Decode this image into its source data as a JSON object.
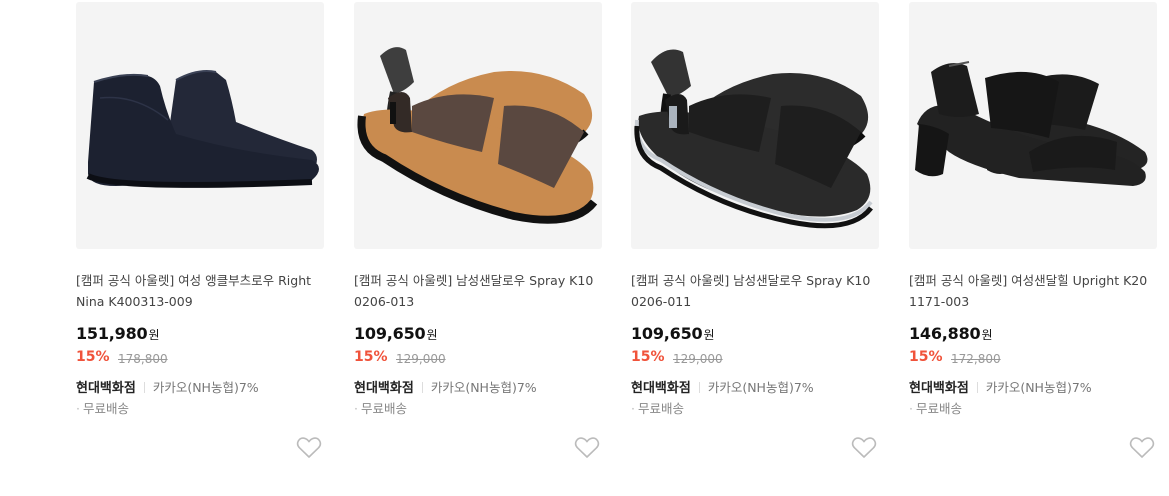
{
  "products": [
    {
      "title": "[캠퍼 공식 아울렛] 여성 앵클부츠로우 Right Nina K400313-009",
      "price": "151,980",
      "currency": "원",
      "discount": "15%",
      "original_price": "178,800",
      "seller": "현대백화점",
      "promo": "카카오(NH농협)7%",
      "shipping": "무료배송",
      "image_icon": "ankle-boot-image",
      "color": "#1f2433"
    },
    {
      "title": "[캠퍼 공식 아울렛] 남성샌달로우 Spray K100206-013",
      "price": "109,650",
      "currency": "원",
      "discount": "15%",
      "original_price": "129,000",
      "seller": "현대백화점",
      "promo": "카카오(NH농협)7%",
      "shipping": "무료배송",
      "image_icon": "sandal-image",
      "color": "#5b4a42"
    },
    {
      "title": "[캠퍼 공식 아울렛] 남성샌달로우 Spray K100206-011",
      "price": "109,650",
      "currency": "원",
      "discount": "15%",
      "original_price": "129,000",
      "seller": "현대백화점",
      "promo": "카카오(NH농협)7%",
      "shipping": "무료배송",
      "image_icon": "sandal-image",
      "color": "#222222"
    },
    {
      "title": "[캠퍼 공식 아울렛] 여성샌달힐 Upright K201171-003",
      "price": "146,880",
      "currency": "원",
      "discount": "15%",
      "original_price": "172,800",
      "seller": "현대백화점",
      "promo": "카카오(NH농협)7%",
      "shipping": "무료배송",
      "image_icon": "heeled-sandal-image",
      "color": "#1a1a1a"
    }
  ],
  "theme": {
    "discount_color": "#f0533b",
    "thumb_bg": "#f4f4f4"
  },
  "icons": {
    "wishlist": "heart-outline-icon",
    "bullet": "dot-icon"
  },
  "bullet_glyph": "·"
}
